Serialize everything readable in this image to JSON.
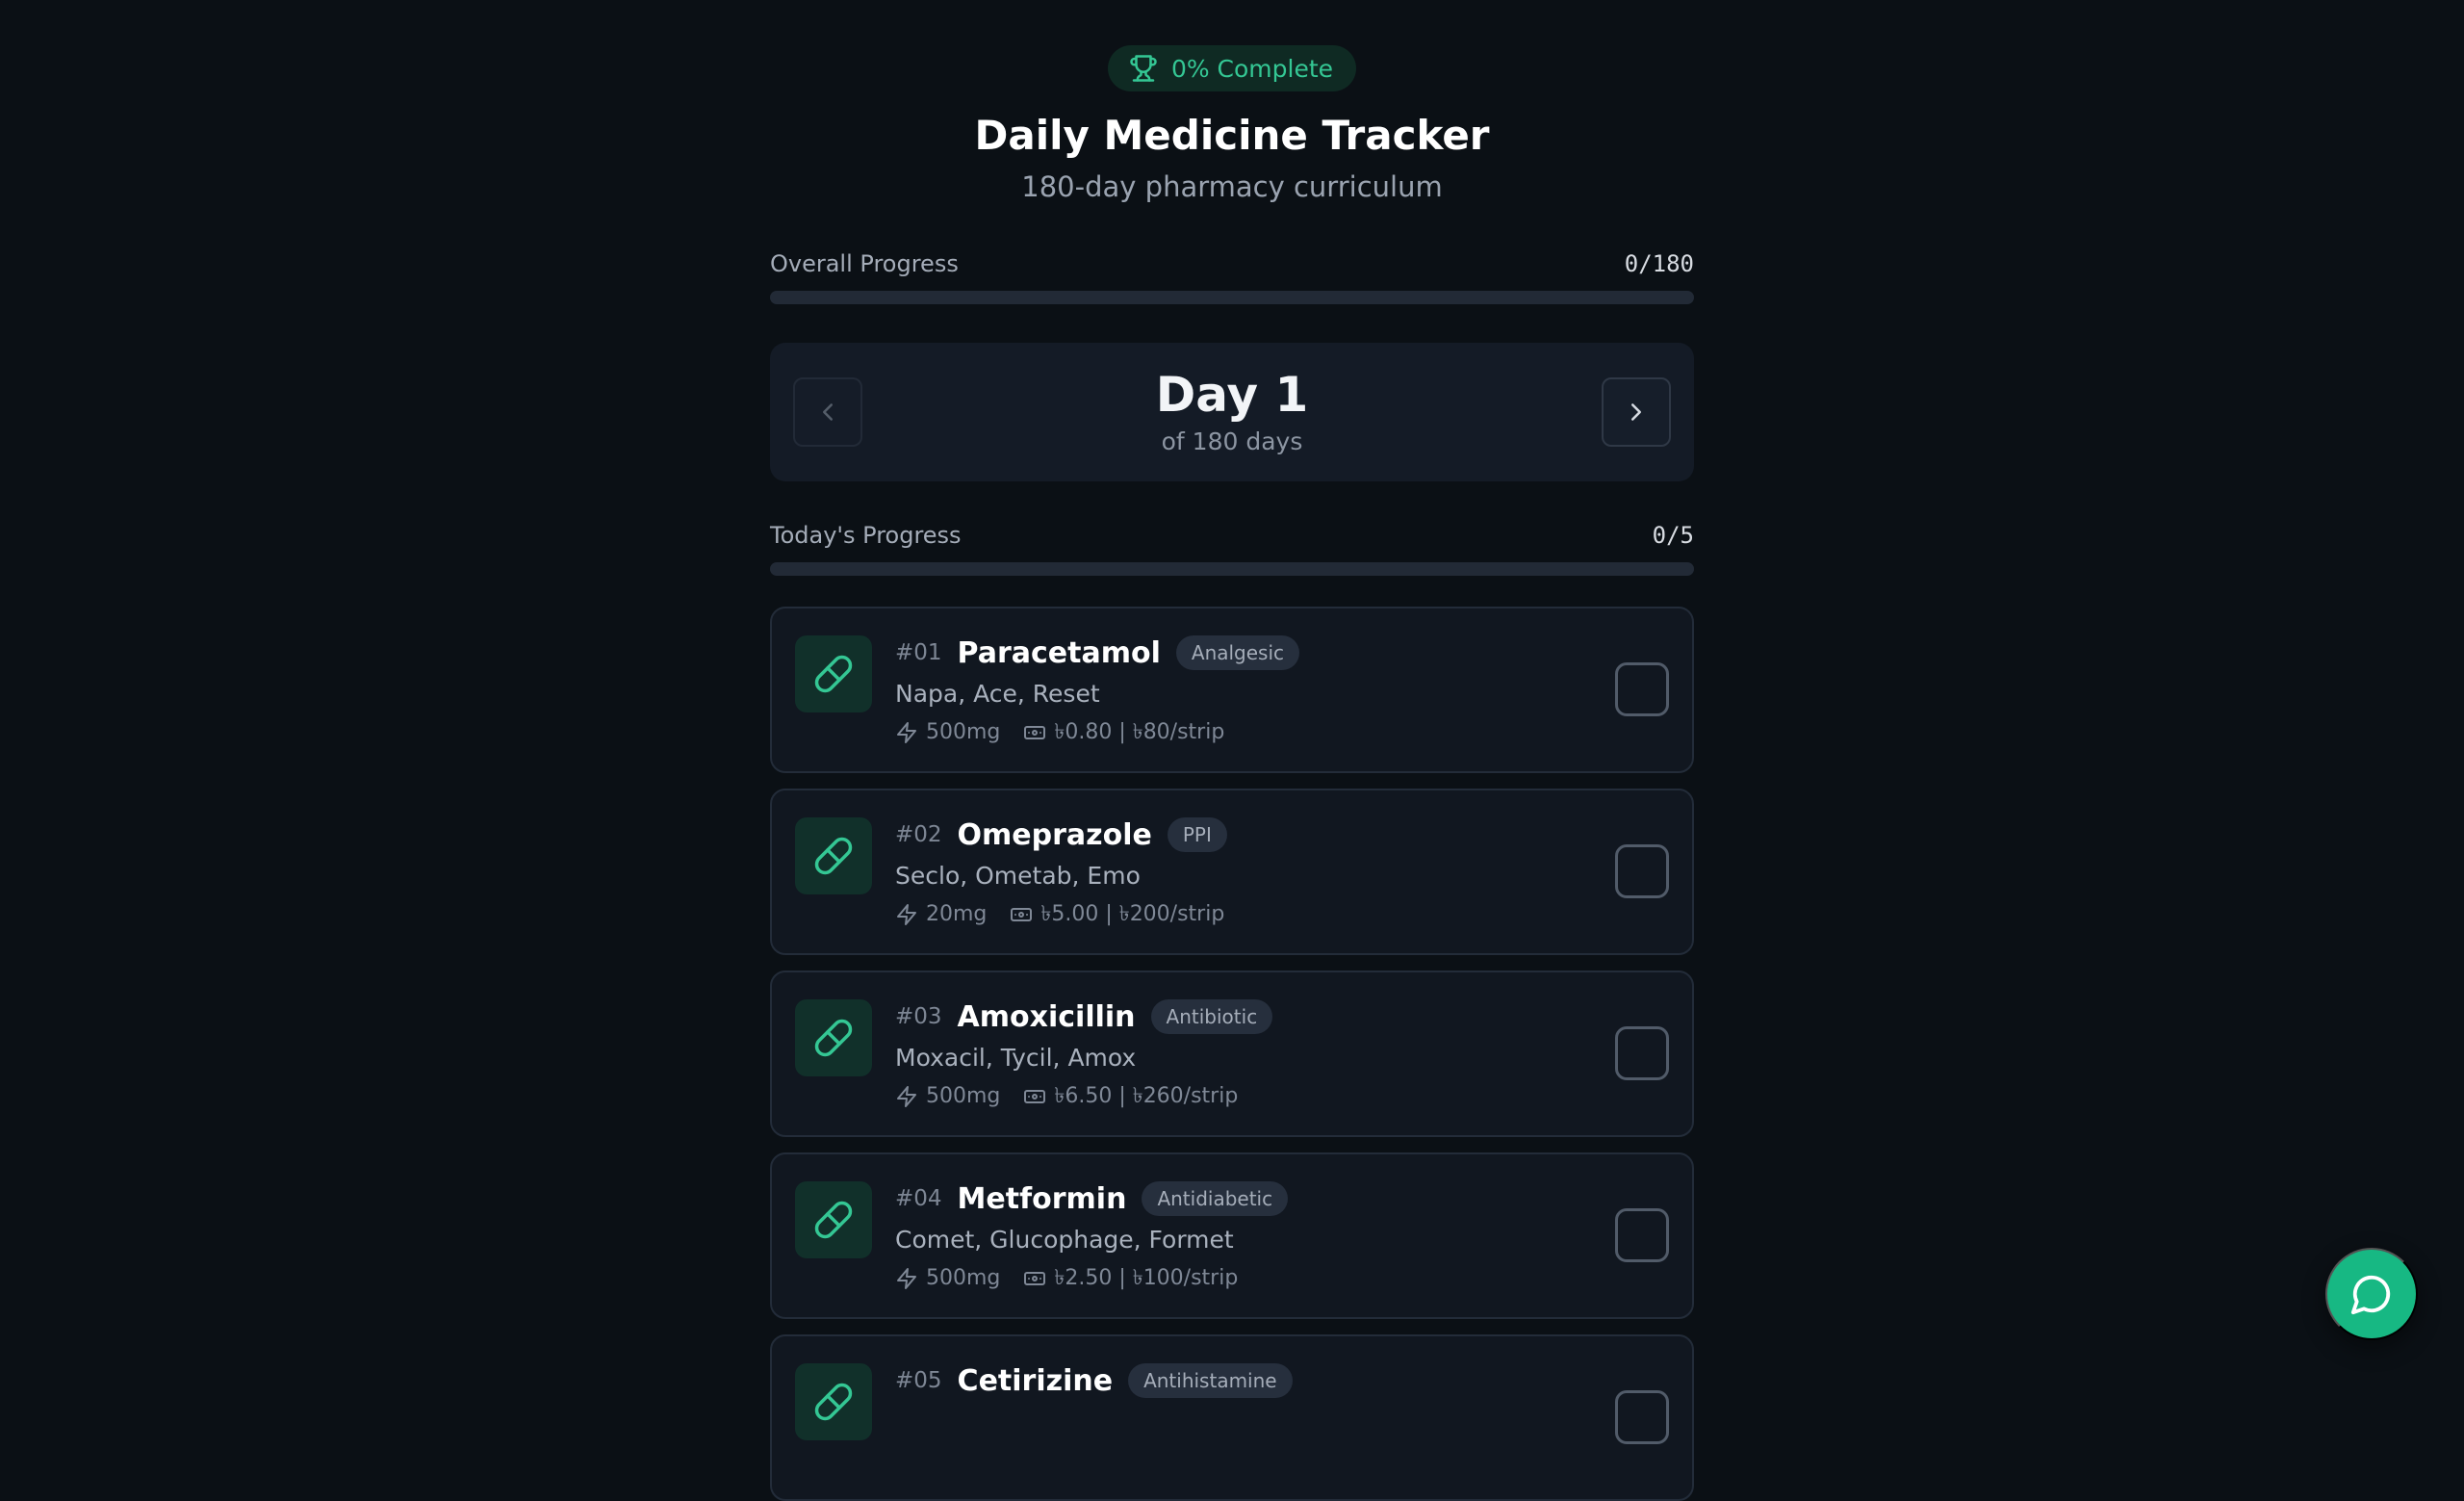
{
  "header": {
    "completion_badge": "0% Complete",
    "title": "Daily Medicine Tracker",
    "subtitle": "180-day pharmacy curriculum"
  },
  "overall_progress": {
    "label": "Overall Progress",
    "count": "0/180",
    "fraction": 0
  },
  "day_nav": {
    "title": "Day 1",
    "subtitle": "of 180 days"
  },
  "today_progress": {
    "label": "Today's Progress",
    "count": "0/5",
    "fraction": 0
  },
  "medicines": [
    {
      "number": "#01",
      "name": "Paracetamol",
      "category": "Analgesic",
      "brands": "Napa, Ace, Reset",
      "dose": "500mg",
      "price": "৳0.80 | ৳80/strip",
      "checked": false
    },
    {
      "number": "#02",
      "name": "Omeprazole",
      "category": "PPI",
      "brands": "Seclo, Ometab, Emo",
      "dose": "20mg",
      "price": "৳5.00 | ৳200/strip",
      "checked": false
    },
    {
      "number": "#03",
      "name": "Amoxicillin",
      "category": "Antibiotic",
      "brands": "Moxacil, Tycil, Amox",
      "dose": "500mg",
      "price": "৳6.50 | ৳260/strip",
      "checked": false
    },
    {
      "number": "#04",
      "name": "Metformin",
      "category": "Antidiabetic",
      "brands": "Comet, Glucophage, Formet",
      "dose": "500mg",
      "price": "৳2.50 | ৳100/strip",
      "checked": false
    },
    {
      "number": "#05",
      "name": "Cetirizine",
      "category": "Antihistamine",
      "brands": "",
      "dose": "",
      "price": "",
      "checked": false
    }
  ],
  "icons": {
    "badge": "trophy-icon",
    "prev": "chevron-left-icon",
    "next": "chevron-right-icon",
    "medicine": "pill-icon",
    "dose": "lightning-icon",
    "price": "banknote-icon",
    "fab": "chat-bubble-icon"
  },
  "colors": {
    "accent": "#17b883",
    "background": "#0b1015",
    "card": "#111720"
  }
}
